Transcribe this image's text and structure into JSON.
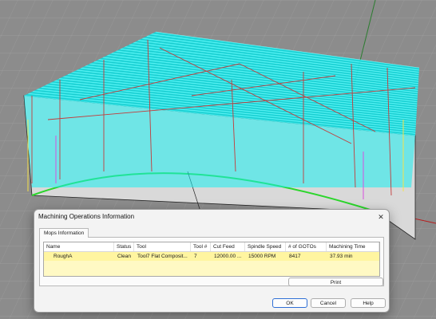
{
  "colors": {
    "toolpath": "#18eef0",
    "rapid_moves": "#c43a3a",
    "grid_background": "#8f8f8f",
    "boundary": "#3ad93a",
    "highlight_row": "#fff5a0",
    "default_button_border": "#2f6fd6"
  },
  "dialog": {
    "title": "Machining Operations Information",
    "close_icon": "close-icon",
    "tab_label": "Mops Information",
    "columns": [
      "Name",
      "Status",
      "Tool",
      "Tool #",
      "Cut Feed",
      "Spindle Speed",
      "# of GOTOs",
      "Machining Time"
    ],
    "rows": [
      [
        "RoughA",
        "Clean",
        "Tool7 Flat Composit...",
        "7",
        "12000.00 ...",
        "15000 RPM",
        "8417",
        "37.93 min"
      ]
    ],
    "print_label": "Print",
    "ok_label": "OK",
    "cancel_label": "Cancel",
    "help_label": "Help"
  }
}
